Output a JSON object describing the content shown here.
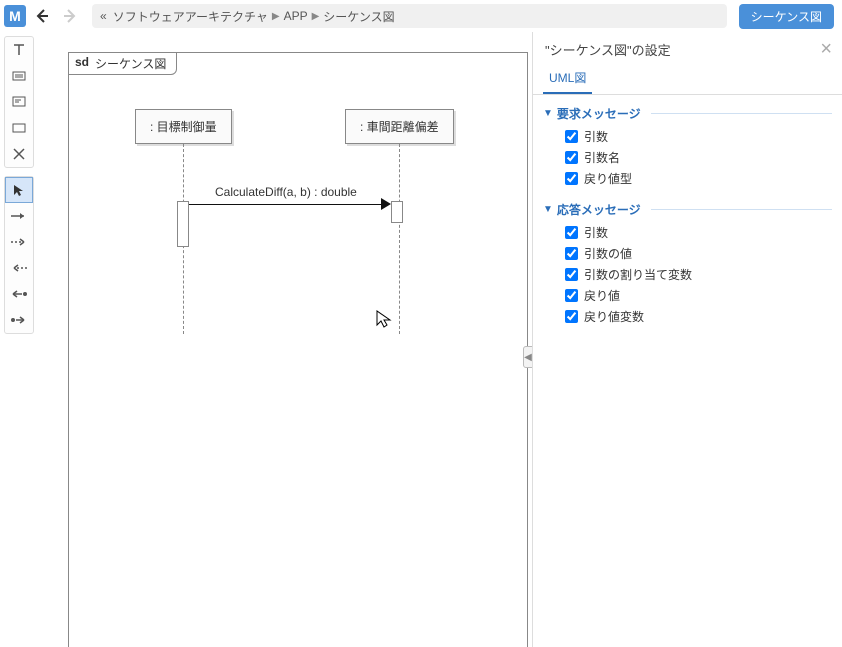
{
  "app_icon_letter": "M",
  "breadcrumb": {
    "prefix": "«",
    "items": [
      "ソフトウェアアーキテクチャ",
      "APP",
      "シーケンス図"
    ]
  },
  "diagram_button": "シーケンス図",
  "frame": {
    "prefix": "sd",
    "name": "シーケンス図"
  },
  "lifelines": [
    {
      "label": ": 目標制御量"
    },
    {
      "label": ": 車間距離偏差"
    }
  ],
  "message": {
    "label": "CalculateDiff(a, b) : double"
  },
  "panel": {
    "title": "\"シーケンス図\"の設定",
    "tab": "UML図",
    "sections": [
      {
        "title": "要求メッセージ",
        "items": [
          "引数",
          "引数名",
          "戻り値型"
        ]
      },
      {
        "title": "応答メッセージ",
        "items": [
          "引数",
          "引数の値",
          "引数の割り当て変数",
          "戻り値",
          "戻り値変数"
        ]
      }
    ]
  }
}
